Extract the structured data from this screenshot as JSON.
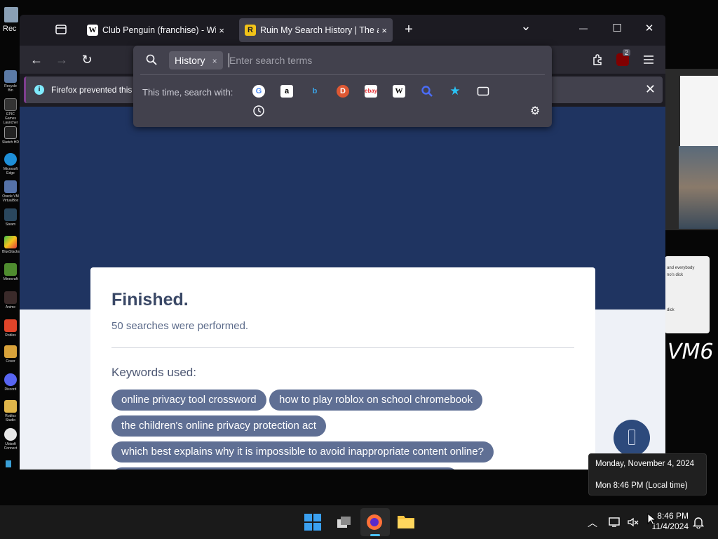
{
  "desktop": {
    "recycle_label": "Rec",
    "icons": [
      "Recycle Bin",
      "EPIC Games Launcher",
      "Sketch HD",
      "Microsoft Edge",
      "Oracle VM VirtualBox",
      "Steam",
      "BlueStacks",
      "Minecraft",
      "Anime",
      "Roblox",
      "Cover",
      "Discord",
      "Roblox Studio",
      "Ubisoft Connect"
    ],
    "bg_note_lines": [
      "and everybody",
      "no's dick",
      "dick"
    ],
    "handwriting": "VM6"
  },
  "tabs": [
    {
      "title": "Club Penguin (franchise) - Wiki",
      "favicon": "W",
      "close": "×"
    },
    {
      "title": "Ruin My Search History | The ar",
      "favicon": "R",
      "close": "×"
    }
  ],
  "tab_actions": {
    "new_tab": "+",
    "list_all_tabs": "⌄"
  },
  "window_controls": {
    "minimize": "—",
    "maximize": "☐",
    "close": "✕"
  },
  "nav": {
    "back": "←",
    "forward": "→",
    "reload": "↻",
    "extensions_badge": "2"
  },
  "infobar": {
    "message": "Firefox prevented this s",
    "close": "✕"
  },
  "search": {
    "chip_label": "History",
    "chip_close": "×",
    "placeholder": "Enter search terms",
    "engines_label": "This time, search with:",
    "engines": [
      "Google",
      "Amazon",
      "Bing",
      "DuckDuckGo",
      "eBay",
      "Wikipedia",
      "Search",
      "Bookmarks",
      "Tabs",
      "History"
    ]
  },
  "page": {
    "heading": "Finished.",
    "subheading": "50 searches were performed.",
    "keywords_title": "Keywords used:",
    "keywords": [
      "online privacy tool crossword",
      "how to play roblox on school chromebook",
      "the children's online privacy protection act",
      "which best explains why it is impossible to avoid inappropriate content online?"
    ]
  },
  "tooltip": {
    "date_line": "Monday, November 4, 2024",
    "time_line": "Mon 8:46 PM (Local time)"
  },
  "taskbar": {
    "time": "8:46 PM",
    "date": "11/4/2024"
  },
  "colors": {
    "navy": "#1f3461",
    "pill": "#5f6f94",
    "heading": "#3a4866"
  }
}
